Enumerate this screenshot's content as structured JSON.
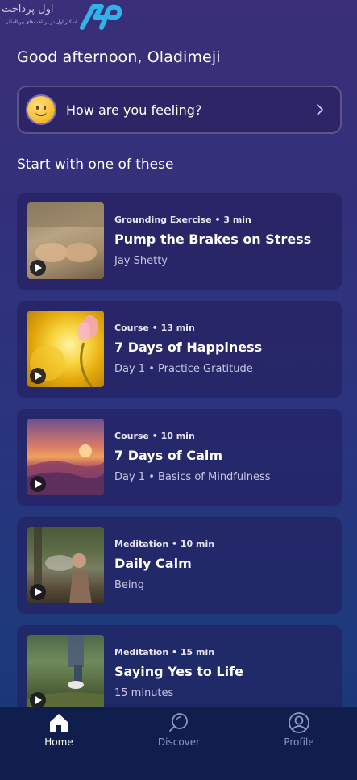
{
  "watermark": {
    "text_top": "اول پرداخت",
    "text_bottom": "اسکنر اول در پرداخت‌های بین‌المللی",
    "logo_text": "AP"
  },
  "greeting": "Good afternoon, Oladimeji",
  "mood_prompt": {
    "label": "How are you feeling?",
    "icon": "smiley-emoji-icon"
  },
  "section_title": "Start with one of these",
  "cards": [
    {
      "meta": "Grounding Exercise • 3 min",
      "title": "Pump the Brakes on Stress",
      "subtitle": "Jay Shetty"
    },
    {
      "meta": "Course • 13 min",
      "title": "7 Days of Happiness",
      "subtitle": "Day 1 • Practice Gratitude"
    },
    {
      "meta": "Course • 10 min",
      "title": "7 Days of Calm",
      "subtitle": "Day 1 • Basics of Mindfulness"
    },
    {
      "meta": "Meditation • 10 min",
      "title": "Daily Calm",
      "subtitle": "Being"
    },
    {
      "meta": "Meditation • 15 min",
      "title": "Saying Yes to Life",
      "subtitle": "15 minutes"
    }
  ],
  "nav": {
    "home": "Home",
    "discover": "Discover",
    "profile": "Profile"
  },
  "colors": {
    "background_top": "#3a2f78",
    "background_bottom": "#17336d",
    "nav_background": "#0f1e4d",
    "nav_inactive": "#8f97bf",
    "logo_blue": "#2fb4ea"
  }
}
